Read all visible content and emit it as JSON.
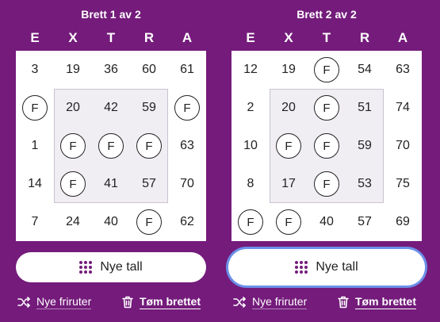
{
  "letters": [
    "E",
    "X",
    "T",
    "R",
    "A"
  ],
  "boards": [
    {
      "title": "Brett 1 av 2",
      "focused": false,
      "cells": [
        [
          "3",
          "19",
          "36",
          "60",
          "61"
        ],
        [
          "F",
          "20",
          "42",
          "59",
          "F"
        ],
        [
          "1",
          "F",
          "F",
          "F",
          "63"
        ],
        [
          "14",
          "F",
          "41",
          "57",
          "70"
        ],
        [
          "7",
          "24",
          "40",
          "F",
          "62"
        ]
      ]
    },
    {
      "title": "Brett 2 av 2",
      "focused": true,
      "cells": [
        [
          "12",
          "19",
          "F",
          "54",
          "63"
        ],
        [
          "2",
          "20",
          "F",
          "51",
          "74"
        ],
        [
          "10",
          "F",
          "F",
          "59",
          "70"
        ],
        [
          "8",
          "17",
          "F",
          "53",
          "75"
        ],
        [
          "F",
          "F",
          "40",
          "57",
          "69"
        ]
      ]
    }
  ],
  "buttons": {
    "new_numbers": "Nye tall",
    "new_free": "Nye friruter",
    "clear_board": "Tøm brettet"
  },
  "icons": {
    "grid": "grid-dots-icon",
    "shuffle": "shuffle-icon",
    "trash": "trash-icon"
  },
  "colors": {
    "background": "#741b7b",
    "focus_ring": "#6b8fe8",
    "center_box": "#f0eef3"
  }
}
